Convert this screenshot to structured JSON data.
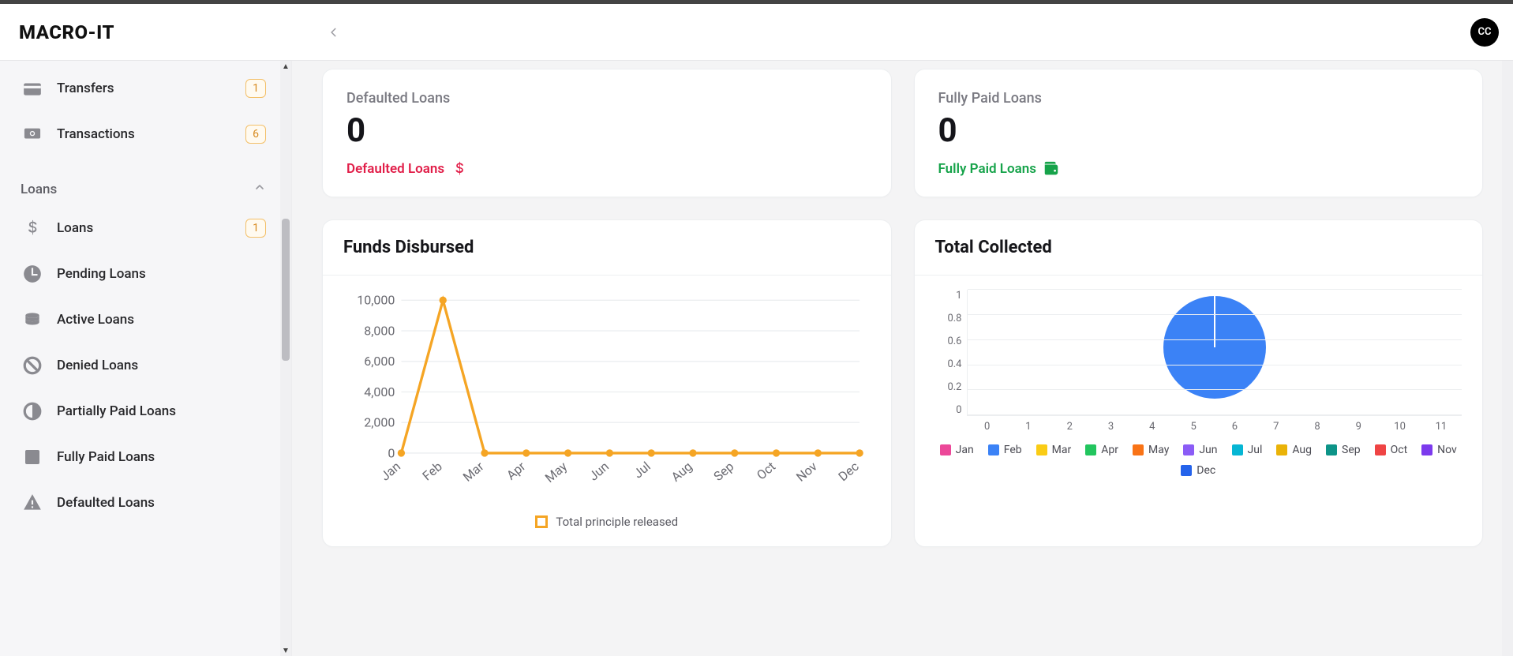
{
  "brand": "MACRO-IT",
  "avatar_initials": "CC",
  "sidebar": {
    "top_items": [
      {
        "label": "Transfers",
        "badge": "1",
        "icon": "wallet"
      },
      {
        "label": "Transactions",
        "badge": "6",
        "icon": "cash"
      }
    ],
    "section_label": "Loans",
    "loan_items": [
      {
        "label": "Loans",
        "badge": "1",
        "icon": "dollar"
      },
      {
        "label": "Pending Loans",
        "badge": null,
        "icon": "clock"
      },
      {
        "label": "Active Loans",
        "badge": null,
        "icon": "coins"
      },
      {
        "label": "Denied Loans",
        "badge": null,
        "icon": "ban"
      },
      {
        "label": "Partially Paid Loans",
        "badge": null,
        "icon": "half"
      },
      {
        "label": "Fully Paid Loans",
        "badge": null,
        "icon": "square"
      },
      {
        "label": "Defaulted Loans",
        "badge": null,
        "icon": "warn"
      }
    ]
  },
  "stats": {
    "defaulted": {
      "title": "Defaulted Loans",
      "value": "0",
      "foot": "Defaulted Loans"
    },
    "fully_paid": {
      "title": "Fully Paid Loans",
      "value": "0",
      "foot": "Fully Paid Loans"
    }
  },
  "funds_title": "Funds Disbursed",
  "funds_legend": "Total principle released",
  "collected_title": "Total Collected",
  "chart_data": [
    {
      "type": "line",
      "title": "Funds Disbursed",
      "series": [
        {
          "name": "Total principle released",
          "values": [
            0,
            10000,
            0,
            0,
            0,
            0,
            0,
            0,
            0,
            0,
            0,
            0
          ]
        }
      ],
      "categories": [
        "Jan",
        "Feb",
        "Mar",
        "Apr",
        "May",
        "Jun",
        "Jul",
        "Aug",
        "Sep",
        "Oct",
        "Nov",
        "Dec"
      ],
      "ylim": [
        0,
        10000
      ],
      "y_ticks": [
        0,
        2000,
        4000,
        6000,
        8000,
        10000
      ],
      "y_tick_labels": [
        "0",
        "2,000",
        "4,000",
        "6,000",
        "8,000",
        "10,000"
      ]
    },
    {
      "type": "pie",
      "title": "Total Collected",
      "categories": [
        "Jan",
        "Feb",
        "Mar",
        "Apr",
        "May",
        "Jun",
        "Jul",
        "Aug",
        "Sep",
        "Oct",
        "Nov",
        "Dec"
      ],
      "values": [
        0,
        1,
        0,
        0,
        0,
        0,
        0,
        0,
        0,
        0,
        0,
        0
      ],
      "colors": [
        "#ec4899",
        "#3b82f6",
        "#facc15",
        "#22c55e",
        "#f97316",
        "#8b5cf6",
        "#06b6d4",
        "#eab308",
        "#0d9488",
        "#ef4444",
        "#7c3aed",
        "#2563eb"
      ],
      "ylim": [
        0,
        1
      ],
      "y_ticks": [
        0,
        0.2,
        0.4,
        0.6,
        0.8,
        1
      ],
      "x_ticks": [
        0,
        1,
        2,
        3,
        4,
        5,
        6,
        7,
        8,
        9,
        10,
        11
      ]
    }
  ]
}
